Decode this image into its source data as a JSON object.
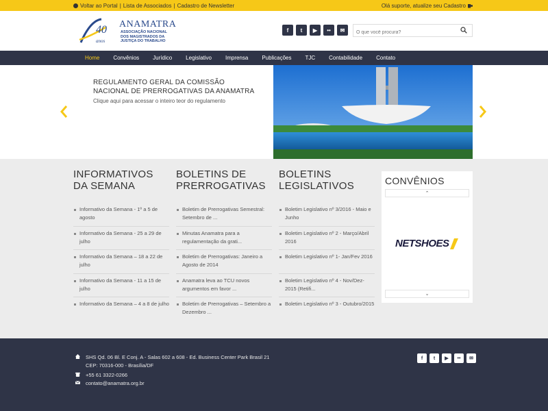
{
  "topbar": {
    "links": [
      "Voltar ao Portal",
      "Lista de Associados",
      "Cadastro de Newsletter"
    ],
    "separator": "|",
    "support": "Olá suporte, atualize seu Cadastro"
  },
  "header": {
    "logo_anniversary": "40",
    "logo_anos": "anos",
    "logo_name": "ANAMATRA",
    "logo_subtitle": [
      "ASSOCIAÇÃO NACIONAL",
      "DOS MAGISTRADOS DA",
      "JUSTIÇA DO TRABALHO"
    ],
    "social": [
      "f",
      "t",
      "▶",
      "••",
      "✉"
    ],
    "search_placeholder": "O que você procura?"
  },
  "nav": {
    "items": [
      "Home",
      "Convênios",
      "Jurídico",
      "Legislativo",
      "Imprensa",
      "Publicações",
      "TJC",
      "Contabilidade",
      "Contato"
    ],
    "active": "Home"
  },
  "slider": {
    "title": "REGULAMENTO GERAL DA COMISSÃO NACIONAL DE PRERROGATIVAS DA ANAMATRA",
    "link": "Clique aqui para acessar o inteiro teor do regulamento"
  },
  "columns": [
    {
      "title": "INFORMATIVOS DA SEMANA",
      "items": [
        "Informativo da Semana - 1º a 5 de agosto",
        "Informativo da Semana - 25 a 29 de julho",
        "Informativo da Semana – 18 a 22 de julho",
        "Informativo da Semana - 11 a 15 de julho",
        "Informativo da Semana – 4 a 8 de julho"
      ]
    },
    {
      "title": "BOLETINS DE PRERROGATIVAS",
      "items": [
        "Boletim de Prerrogativas Semestral: Setembro de ...",
        "Minutas Anamatra para a regulamentação da grati...",
        "Boletim de Prerrogativas: Janeiro a Agosto de 2014",
        "Anamatra leva ao TCU novos argumentos em favor ...",
        "Boletim de Prerrogativas – Setembro a Dezembro ..."
      ]
    },
    {
      "title": "BOLETINS LEGISLATIVOS",
      "items": [
        "Boletim Legislativo nº 3/2016 - Maio e Junho",
        "Boletim Legislativo nº 2 - Março/Abril 2016",
        "Boletim Legislativo nº 1- Jan/Fev 2016",
        "Boletim Legislativo nº 4 - Nov/Dez-2015 (Retifi...",
        "Boletim Legislativo nº 3 - Outubro/2015"
      ]
    }
  ],
  "convenios": {
    "title": "CONVÊNIOS",
    "partner": "NETSHOES"
  },
  "footer": {
    "address_line1": "SHS Qd. 06 Bl. E Conj. A - Salas 602 a 608 - Ed. Business Center Park Brasil 21",
    "address_line2": "CEP: 70316-000 - Brasília/DF",
    "phone": "+55 61 3322-0266",
    "email": "contato@anamatra.org.br",
    "social": [
      "f",
      "t",
      "▶",
      "••",
      "✉"
    ]
  },
  "colors": {
    "accent": "#f6c818",
    "navy": "#2f3447",
    "brand_blue": "#2a4a8c"
  }
}
